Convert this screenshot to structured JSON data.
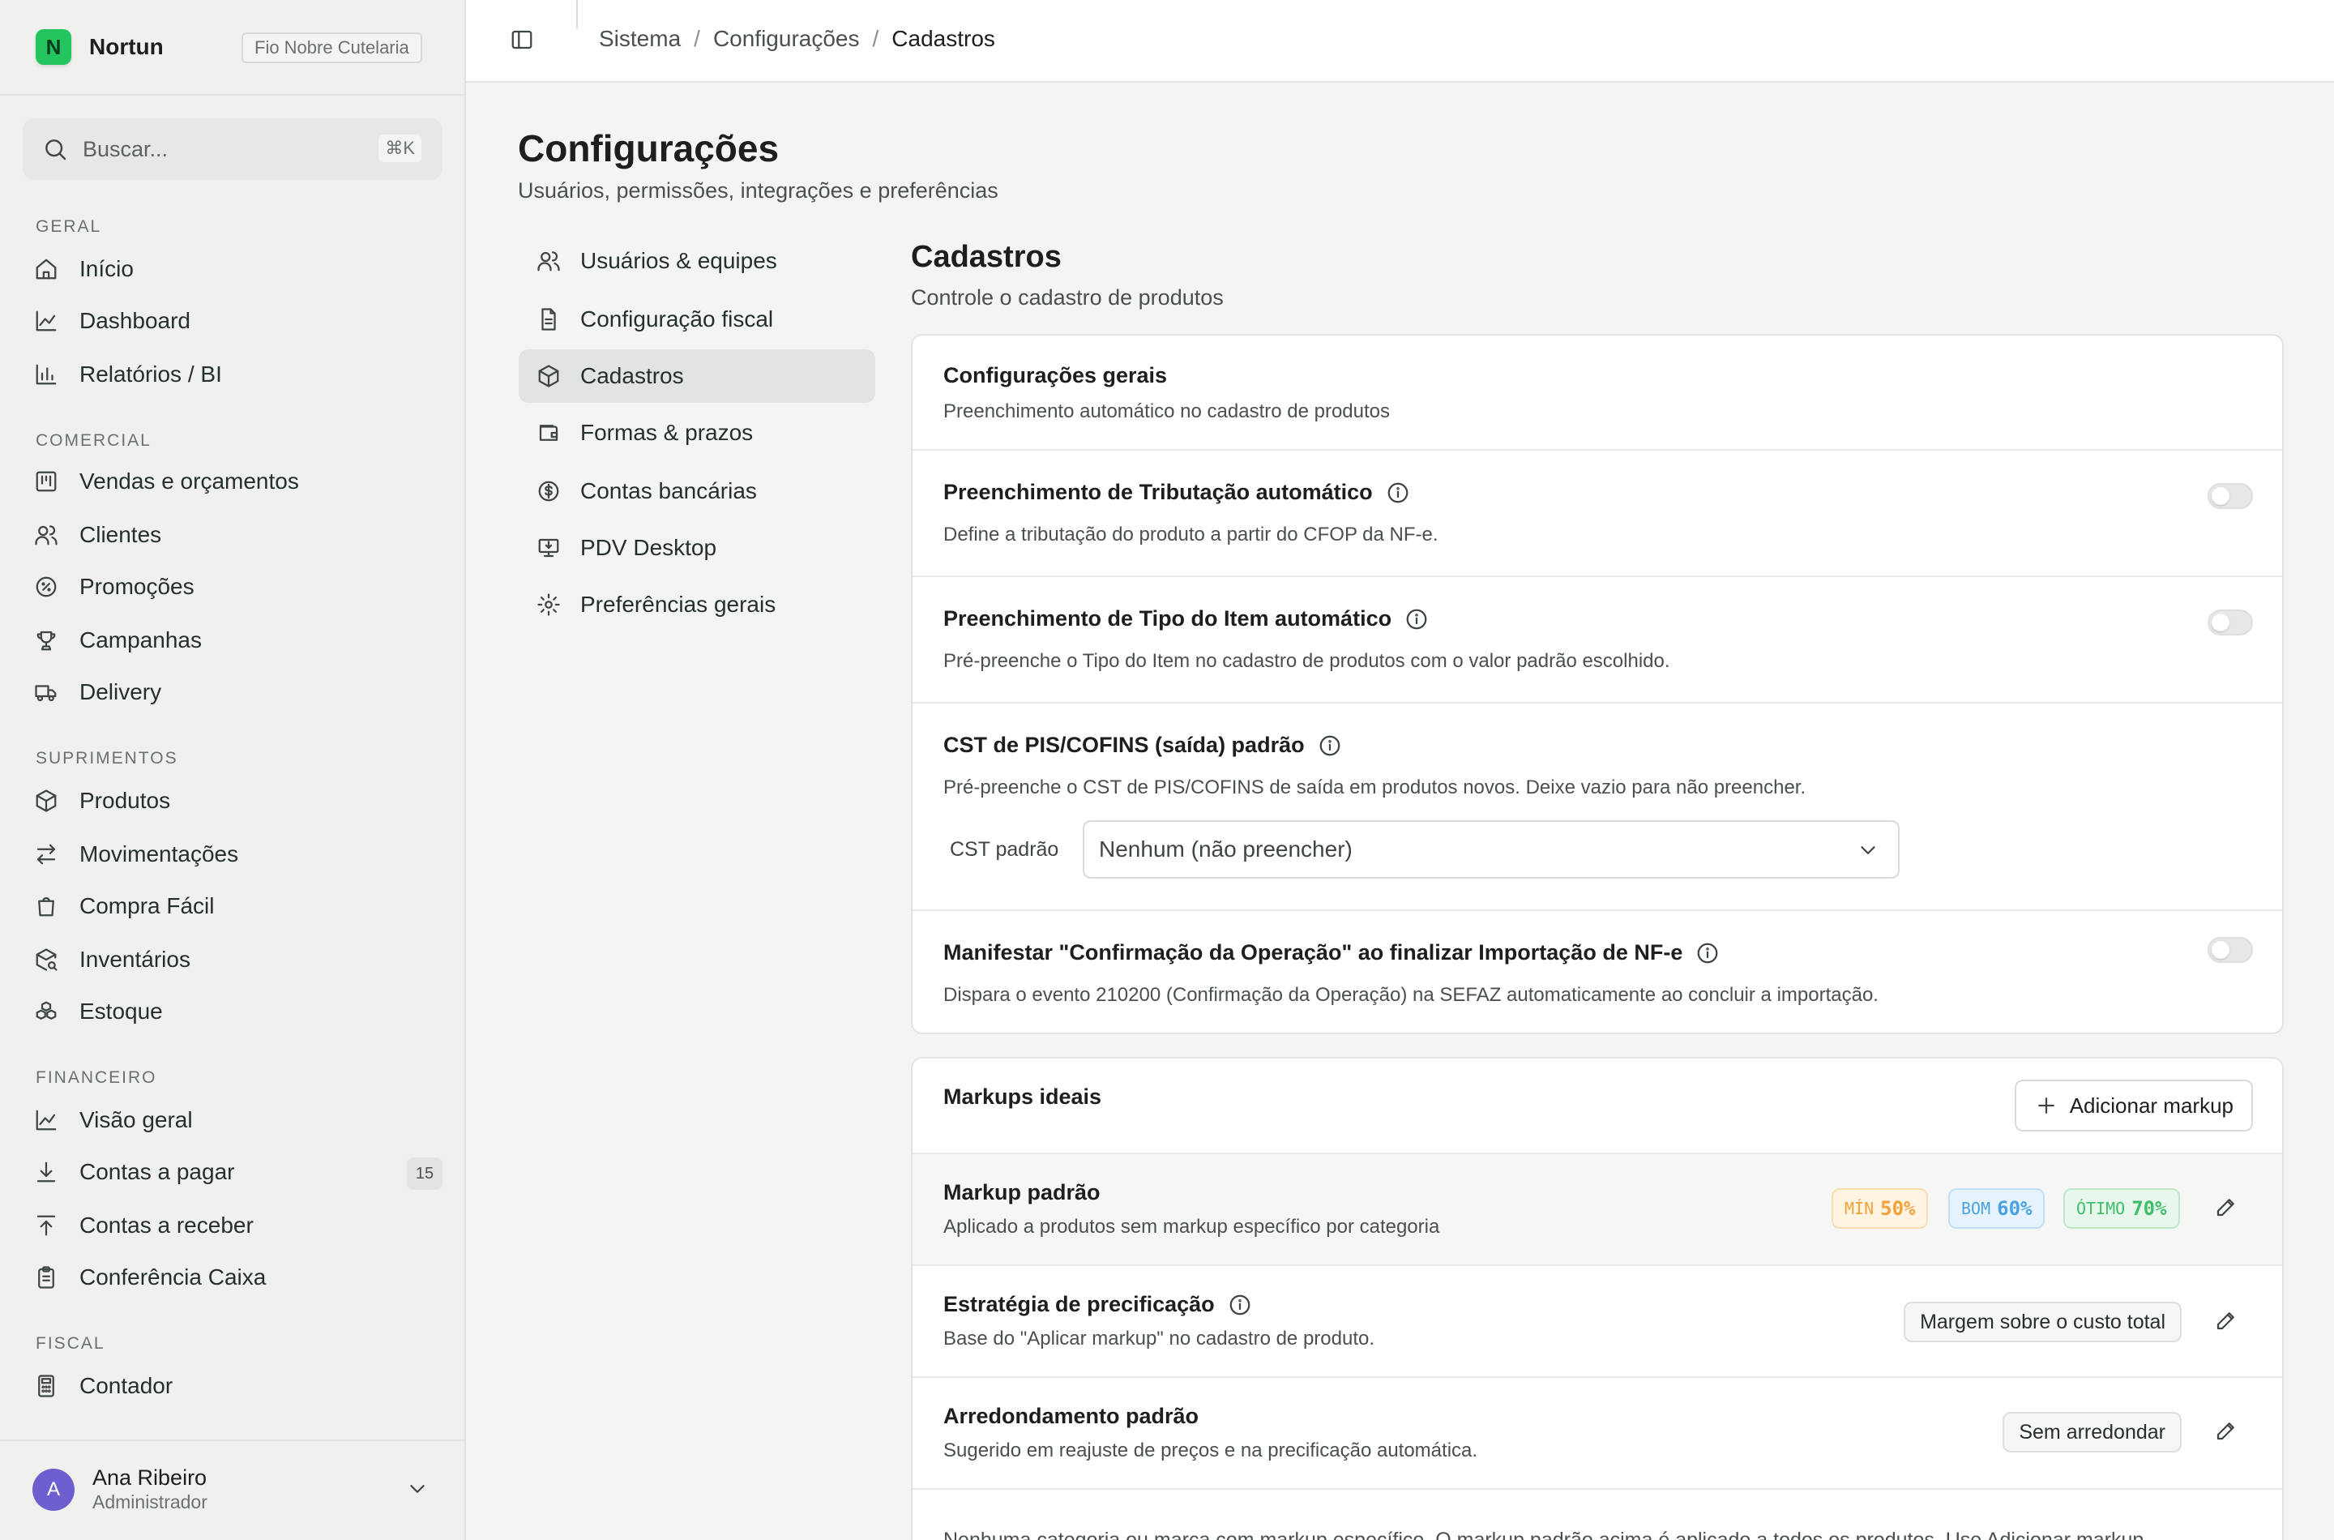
{
  "app": {
    "name": "Nortun",
    "logo_letter": "N",
    "org": "Fio Nobre Cutelaria",
    "accent": "#22c55e"
  },
  "search": {
    "placeholder": "Buscar...",
    "shortcut": "⌘K"
  },
  "sidebar": {
    "sections": [
      {
        "label": "GERAL",
        "items": [
          {
            "label": "Início",
            "icon": "home-icon"
          },
          {
            "label": "Dashboard",
            "icon": "line-chart-icon"
          },
          {
            "label": "Relatórios / BI",
            "icon": "bar-chart-icon"
          }
        ]
      },
      {
        "label": "COMERCIAL",
        "items": [
          {
            "label": "Vendas e orçamentos",
            "icon": "kanban-icon"
          },
          {
            "label": "Clientes",
            "icon": "users-icon"
          },
          {
            "label": "Promoções",
            "icon": "percent-badge-icon"
          },
          {
            "label": "Campanhas",
            "icon": "trophy-icon"
          },
          {
            "label": "Delivery",
            "icon": "truck-icon"
          }
        ]
      },
      {
        "label": "SUPRIMENTOS",
        "items": [
          {
            "label": "Produtos",
            "icon": "box-icon"
          },
          {
            "label": "Movimentações",
            "icon": "arrows-left-right-icon"
          },
          {
            "label": "Compra Fácil",
            "icon": "shopping-bag-icon"
          },
          {
            "label": "Inventários",
            "icon": "package-search-icon"
          },
          {
            "label": "Estoque",
            "icon": "boxes-icon"
          }
        ]
      },
      {
        "label": "FINANCEIRO",
        "items": [
          {
            "label": "Visão geral",
            "icon": "line-chart-icon"
          },
          {
            "label": "Contas a pagar",
            "icon": "arrow-down-to-line-icon",
            "count": "15"
          },
          {
            "label": "Contas a receber",
            "icon": "arrow-up-from-line-icon"
          },
          {
            "label": "Conferência Caixa",
            "icon": "clipboard-list-icon"
          }
        ]
      },
      {
        "label": "FISCAL",
        "items": [
          {
            "label": "Contador",
            "icon": "calculator-icon"
          }
        ]
      }
    ],
    "user": {
      "initial": "A",
      "name": "Ana Ribeiro",
      "role": "Administrador"
    }
  },
  "breadcrumb": {
    "items": [
      "Sistema",
      "Configurações"
    ],
    "current": "Cadastros"
  },
  "page": {
    "title": "Configurações",
    "subtitle": "Usuários, permissões, integrações e preferências"
  },
  "settings_nav": [
    {
      "label": "Usuários & equipes",
      "icon": "users-icon",
      "active": false
    },
    {
      "label": "Configuração fiscal",
      "icon": "file-text-icon",
      "active": false
    },
    {
      "label": "Cadastros",
      "icon": "box-icon",
      "active": true
    },
    {
      "label": "Formas & prazos",
      "icon": "wallet-icon",
      "active": false
    },
    {
      "label": "Contas bancárias",
      "icon": "dollar-circle-icon",
      "active": false
    },
    {
      "label": "PDV Desktop",
      "icon": "monitor-download-icon",
      "active": false
    },
    {
      "label": "Preferências gerais",
      "icon": "gear-icon",
      "active": false
    }
  ],
  "content": {
    "title": "Cadastros",
    "subtitle": "Controle o cadastro de produtos",
    "general": {
      "title": "Configurações gerais",
      "subtitle": "Preenchimento automático no cadastro de produtos",
      "tributacao": {
        "title": "Preenchimento de Tributação automático",
        "desc": "Define a tributação do produto a partir do CFOP da NF-e.",
        "enabled": false
      },
      "tipo_item": {
        "title": "Preenchimento de Tipo do Item automático",
        "desc": "Pré-preenche o Tipo do Item no cadastro de produtos com o valor padrão escolhido.",
        "enabled": false
      },
      "cst": {
        "title": "CST de PIS/COFINS (saída) padrão",
        "desc": "Pré-preenche o CST de PIS/COFINS de saída em produtos novos. Deixe vazio para não preencher.",
        "field_label": "CST padrão",
        "value": "Nenhum (não preencher)"
      },
      "manifestar": {
        "title": "Manifestar \"Confirmação da Operação\" ao finalizar Importação de NF-e",
        "desc": "Dispara o evento 210200 (Confirmação da Operação) na SEFAZ automaticamente ao concluir a importação.",
        "enabled": false
      }
    },
    "markups": {
      "title": "Markups ideais",
      "add_label": "Adicionar markup",
      "default": {
        "title": "Markup padrão",
        "desc": "Aplicado a produtos sem markup específico por categoria",
        "min_label": "MÍN",
        "min_value": "50%",
        "bom_label": "BOM",
        "bom_value": "60%",
        "otimo_label": "ÓTIMO",
        "otimo_value": "70%",
        "colors": {
          "min": "#f0a23a",
          "bom": "#4aa3e0",
          "otimo": "#3fbf6a"
        }
      },
      "estrategia": {
        "title": "Estratégia de precificação",
        "desc": "Base do \"Aplicar markup\" no cadastro de produto.",
        "value": "Margem sobre o custo total"
      },
      "arredondamento": {
        "title": "Arredondamento padrão",
        "desc": "Sugerido em reajuste de preços e na precificação automática.",
        "value": "Sem arredondar"
      },
      "empty_note": "Nenhuma categoria ou marca com markup específico. O markup padrão acima é aplicado a todos os produtos. Use Adicionar markup"
    }
  }
}
